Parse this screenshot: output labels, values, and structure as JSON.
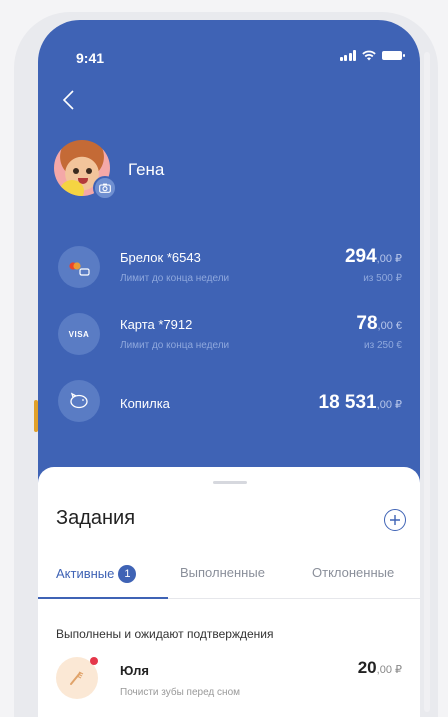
{
  "status_bar": {
    "time": "9:41"
  },
  "profile": {
    "name": "Гена"
  },
  "accounts": [
    {
      "title": "Брелок *6543",
      "subtitle": "Лимит до конца недели",
      "amount_int": "294",
      "amount_frac": ",00 ₽",
      "limit": "из 500 ₽",
      "icon": "mastercard-keyfob-icon"
    },
    {
      "title": "Карта *7912",
      "subtitle": "Лимит до конца недели",
      "amount_int": "78",
      "amount_frac": ",00 €",
      "limit": "из 250 €",
      "icon": "visa-card-icon",
      "icon_text": "VISA"
    },
    {
      "title": "Копилка",
      "amount_int": "18 531",
      "amount_frac": ",00 ₽",
      "icon": "piggy-bank-icon"
    }
  ],
  "tasks": {
    "title": "Задания",
    "tabs": [
      {
        "label": "Активные",
        "badge": "1",
        "active": true
      },
      {
        "label": "Выполненные"
      },
      {
        "label": "Отклоненные"
      }
    ],
    "section_title": "Выполнены и ожидают подтверждения",
    "items": [
      {
        "name": "Юля",
        "description": "Почисти зубы перед сном",
        "amount_int": "20",
        "amount_frac": ",00 ₽",
        "icon": "toothbrush-icon"
      }
    ]
  },
  "colors": {
    "primary": "#3f63b5",
    "accent_red": "#e5374a"
  }
}
